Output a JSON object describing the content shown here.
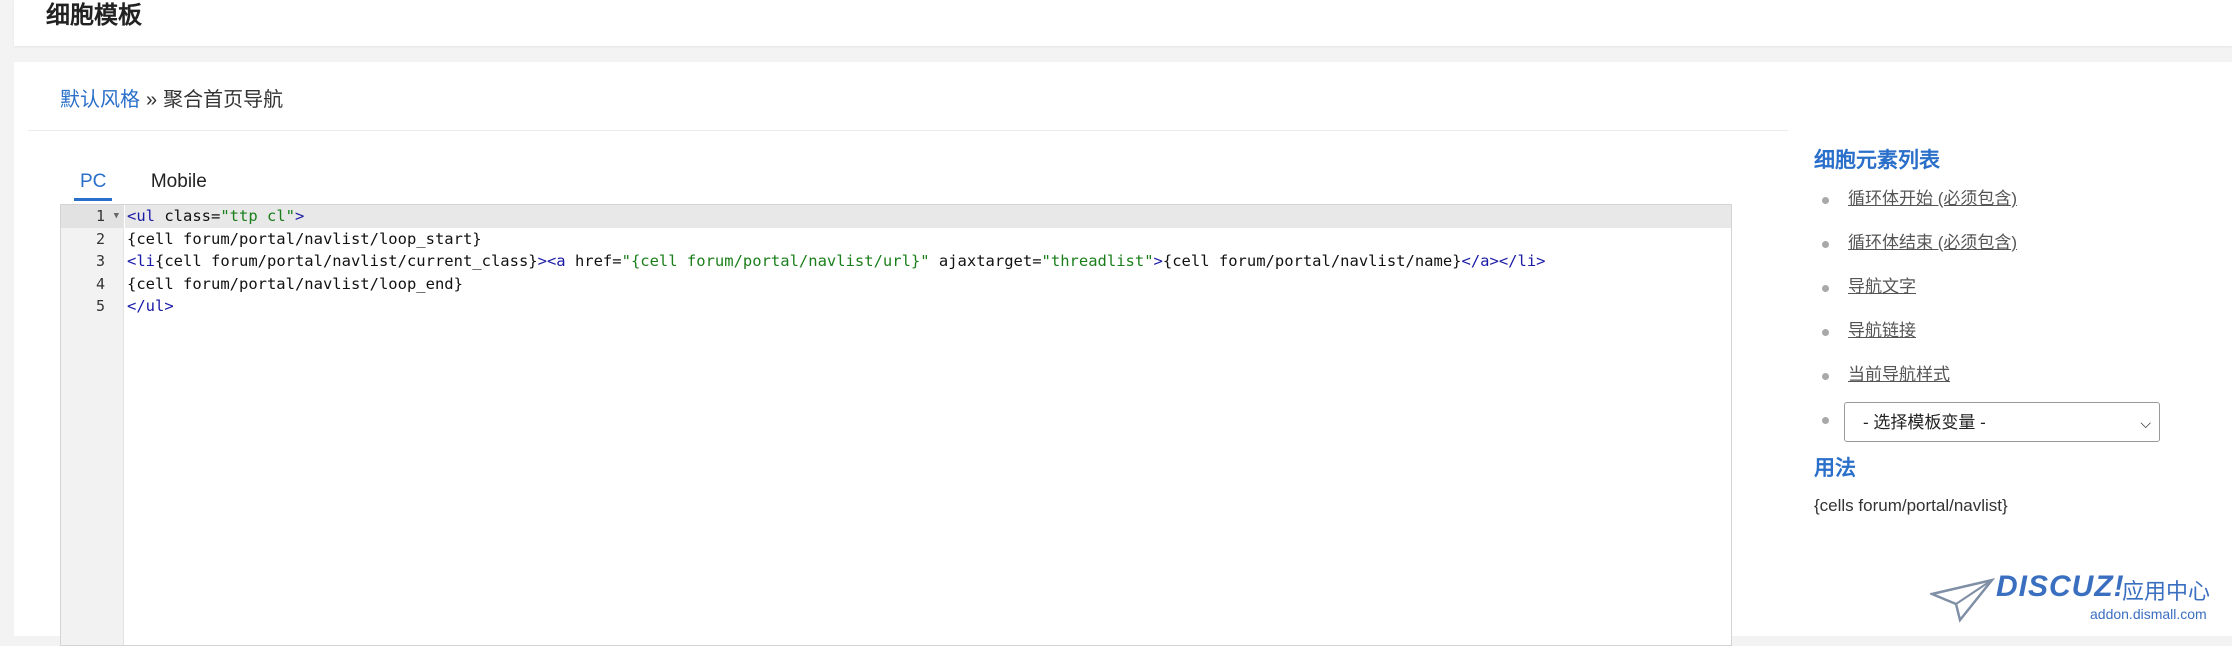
{
  "header": {
    "title": "细胞模板"
  },
  "breadcrumb": {
    "link": "默认风格",
    "separator": "»",
    "current": "聚合首页导航"
  },
  "tabs": [
    {
      "label": "PC",
      "active": true
    },
    {
      "label": "Mobile",
      "active": false
    }
  ],
  "editor": {
    "line_numbers": [
      "1",
      "2",
      "3",
      "4",
      "5"
    ],
    "active_line": 1
  },
  "sidebar": {
    "elements_title": "细胞元素列表",
    "elements": [
      {
        "label": "循环体开始 (必须包含)"
      },
      {
        "label": "循环体结束 (必须包含)"
      },
      {
        "label": "导航文字"
      },
      {
        "label": "导航链接"
      },
      {
        "label": "当前导航样式"
      }
    ],
    "template_select": {
      "selected": "- 选择模板变量 -"
    },
    "usage_title": "用法",
    "usage_value": "{cells forum/portal/navlist}"
  },
  "watermark": {
    "brand": "DISCUZ!",
    "brand_cn": "应用中心",
    "domain": "addon.dismall.com"
  },
  "colors": {
    "accent": "#2a6fc9",
    "tag": "#1a1aa6",
    "string": "#1a7f1a"
  },
  "icons": {
    "fold": "triangle-down",
    "select": "chevron-down",
    "logo": "paper-plane"
  }
}
